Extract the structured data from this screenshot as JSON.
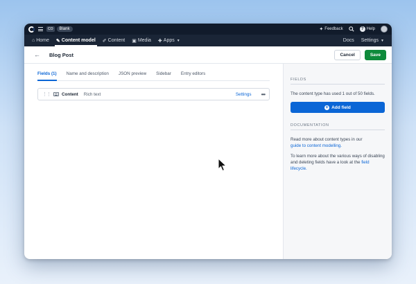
{
  "topbar": {
    "org_badge": "CO",
    "space_name": "Blank",
    "feedback_label": "Feedback",
    "help_label": "Help"
  },
  "nav": {
    "items": [
      {
        "label": "Home",
        "icon": "home-icon"
      },
      {
        "label": "Content model",
        "icon": "wrench-icon"
      },
      {
        "label": "Content",
        "icon": "pen-icon"
      },
      {
        "label": "Media",
        "icon": "image-icon"
      },
      {
        "label": "Apps",
        "icon": "puzzle-icon"
      }
    ],
    "docs_label": "Docs",
    "settings_label": "Settings"
  },
  "header": {
    "title": "Blog Post",
    "cancel_label": "Cancel",
    "save_label": "Save"
  },
  "tabs": [
    {
      "label": "Fields (1)"
    },
    {
      "label": "Name and description"
    },
    {
      "label": "JSON preview"
    },
    {
      "label": "Sidebar"
    },
    {
      "label": "Entry editors"
    }
  ],
  "fields": [
    {
      "name": "Content",
      "type": "Rich text",
      "settings_label": "Settings",
      "more_label": "•••"
    }
  ],
  "sidebar": {
    "fields_heading": "FIELDS",
    "fields_usage": "The content type has used 1 out of 50 fields.",
    "add_field_label": "Add field",
    "documentation_heading": "DOCUMENTATION",
    "doc_text_1": "Read more about content types in our",
    "doc_link_1": "guide to content modelling.",
    "doc_text_2": "To learn more about the various ways of disabling and deleting fields have a look at the",
    "doc_link_2": "field lifecycle."
  },
  "colors": {
    "brand_dark": "#111b2b",
    "nav_bg": "#1a2536",
    "accent_blue": "#0b66d6",
    "save_green": "#0e8a3b"
  }
}
